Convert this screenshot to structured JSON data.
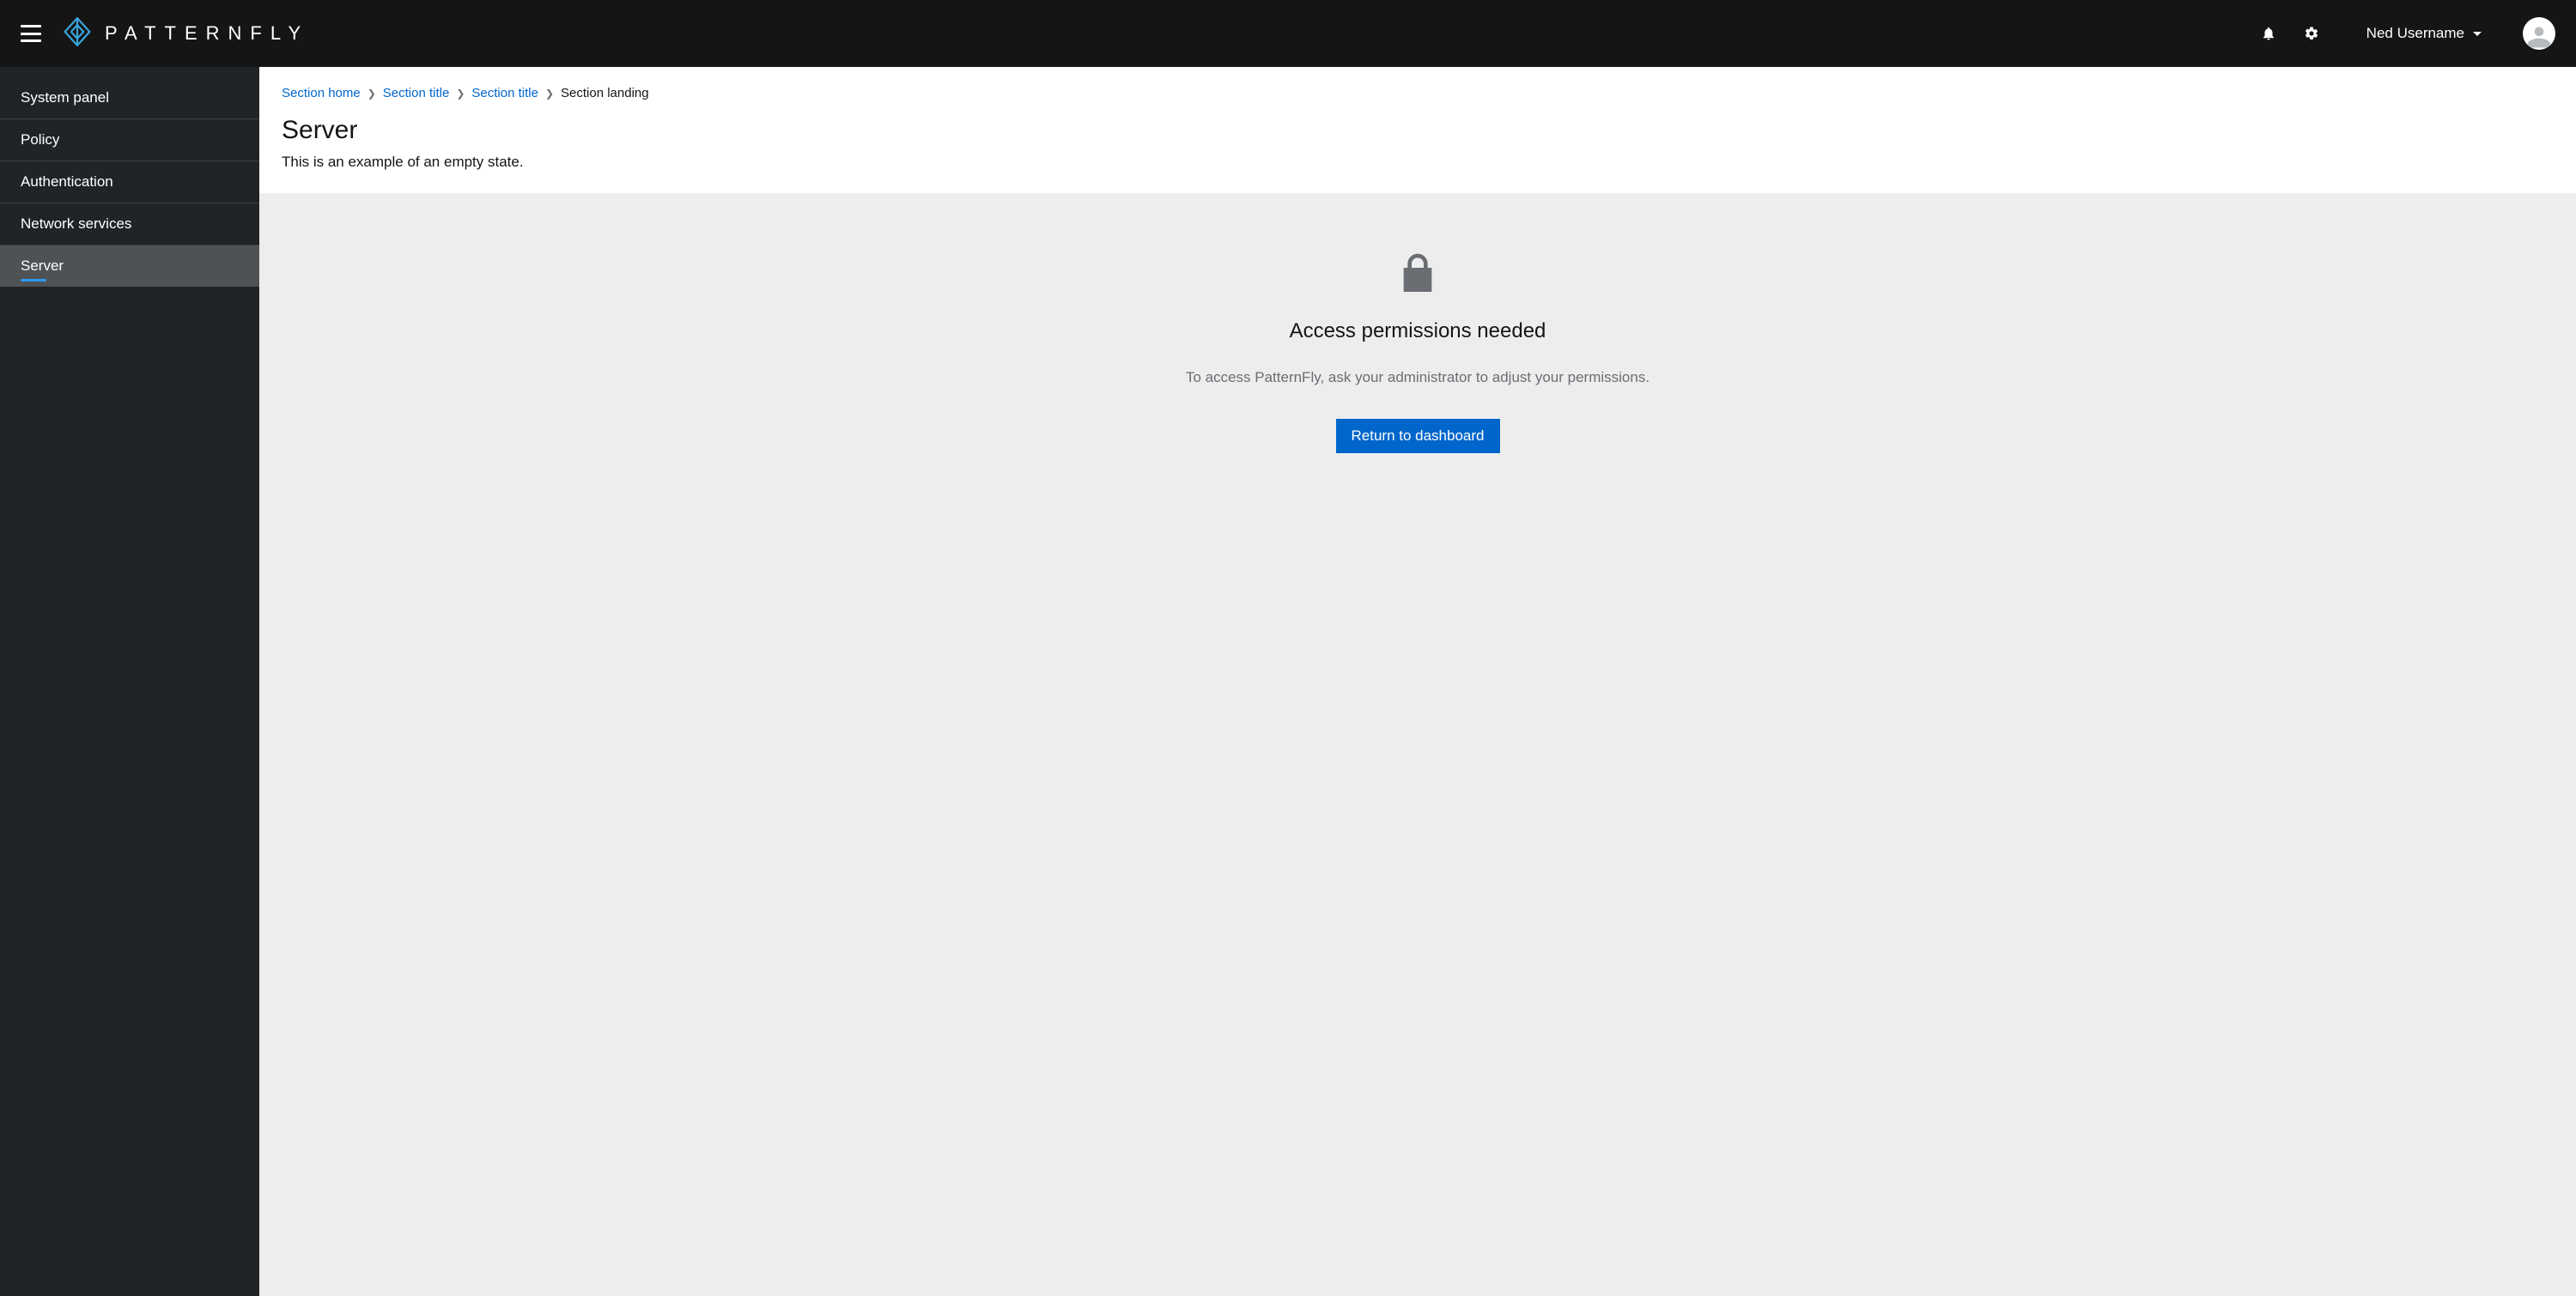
{
  "header": {
    "brand": "PATTERNFLY",
    "user": "Ned Username"
  },
  "sidebar": {
    "items": [
      {
        "label": "System panel",
        "active": false
      },
      {
        "label": "Policy",
        "active": false
      },
      {
        "label": "Authentication",
        "active": false
      },
      {
        "label": "Network services",
        "active": false
      },
      {
        "label": "Server",
        "active": true
      }
    ]
  },
  "breadcrumb": {
    "items": [
      {
        "label": "Section home",
        "link": true
      },
      {
        "label": "Section title",
        "link": true
      },
      {
        "label": "Section title",
        "link": true
      },
      {
        "label": "Section landing",
        "link": false
      }
    ]
  },
  "page": {
    "title": "Server",
    "subtitle": "This is an example of an empty state."
  },
  "empty_state": {
    "title": "Access permissions needed",
    "body": "To access PatternFly, ask your administrator to adjust your permissions.",
    "primary_button": "Return to dashboard"
  }
}
